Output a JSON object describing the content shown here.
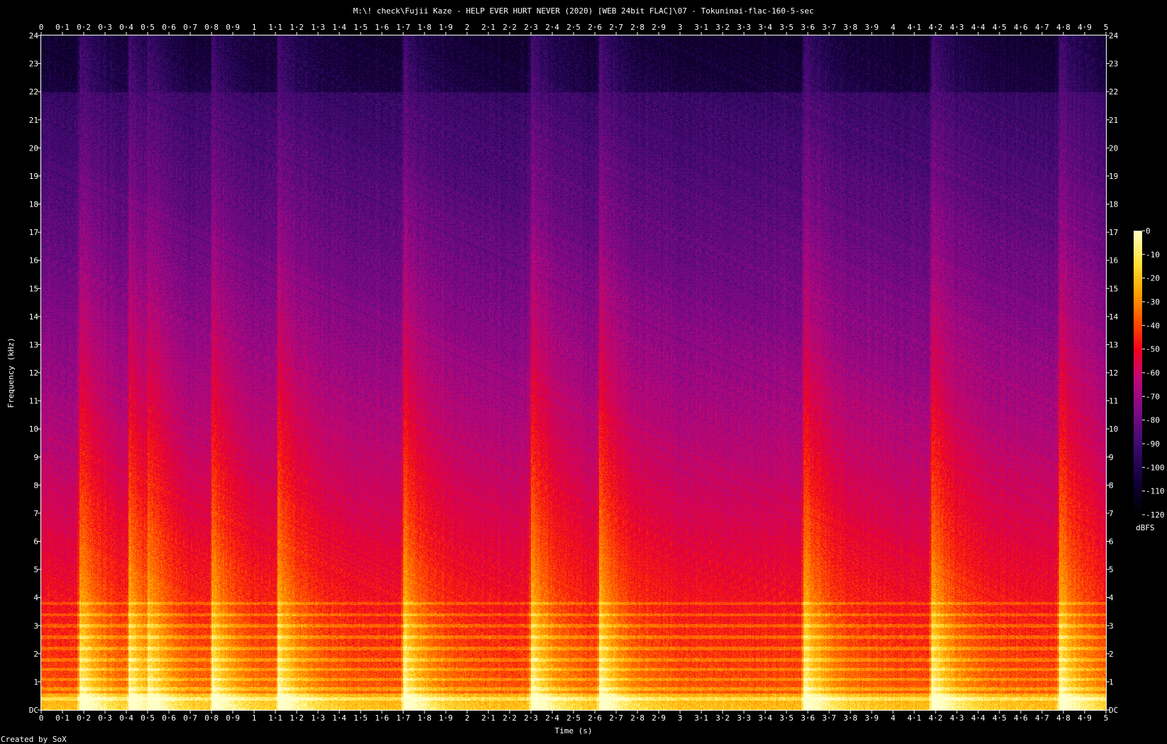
{
  "chart_data": {
    "type": "heatmap",
    "subtype": "spectrogram",
    "title": "M:\\! check\\Fujii Kaze - HELP EVER HURT NEVER (2020) [WEB 24bit FLAC]\\07 - Tokuninai-flac-160-5-sec",
    "xlabel": "Time (s)",
    "ylabel": "Frequency (kHz)",
    "xlim": [
      0,
      5
    ],
    "ylim": [
      0,
      24
    ],
    "x_ticks": [
      "0",
      "0·1",
      "0·2",
      "0·3",
      "0·4",
      "0·5",
      "0·6",
      "0·7",
      "0·8",
      "0·9",
      "1",
      "1·1",
      "1·2",
      "1·3",
      "1·4",
      "1·5",
      "1·6",
      "1·7",
      "1·8",
      "1·9",
      "2",
      "2·1",
      "2·2",
      "2·3",
      "2·4",
      "2·5",
      "2·6",
      "2·7",
      "2·8",
      "2·9",
      "3",
      "3·1",
      "3·2",
      "3·3",
      "3·4",
      "3·5",
      "3·6",
      "3·7",
      "3·8",
      "3·9",
      "4",
      "4·1",
      "4·2",
      "4·3",
      "4·4",
      "4·5",
      "4·6",
      "4·7",
      "4·8",
      "4·9",
      "5"
    ],
    "y_ticks": [
      "DC",
      "1",
      "2",
      "3",
      "4",
      "5",
      "6",
      "7",
      "8",
      "9",
      "10",
      "11",
      "12",
      "13",
      "14",
      "15",
      "16",
      "17",
      "18",
      "19",
      "20",
      "21",
      "22",
      "23",
      "24"
    ],
    "colorbar": {
      "label": "dBFS",
      "range": [
        -120,
        0
      ],
      "ticks": [
        "0",
        "-10",
        "-20",
        "-30",
        "-40",
        "-50",
        "-60",
        "-70",
        "-80",
        "-90",
        "-100",
        "-110",
        "-120"
      ]
    },
    "colormap": [
      "#000000",
      "#12003a",
      "#3a0b6e",
      "#7a0a88",
      "#c0087a",
      "#f2001c",
      "#ff5000",
      "#ffa000",
      "#ffe030",
      "#ffffc8"
    ],
    "onset_times_s": [
      0.18,
      0.41,
      0.5,
      0.8,
      1.11,
      1.7,
      2.3,
      2.62,
      3.58,
      4.18,
      4.78
    ],
    "tonal_harmonics_khz": [
      0.4,
      0.75,
      1.1,
      1.45,
      1.8,
      2.2,
      2.6,
      3.0,
      3.4,
      3.8
    ]
  },
  "footer": {
    "credit": "Created by SoX"
  }
}
